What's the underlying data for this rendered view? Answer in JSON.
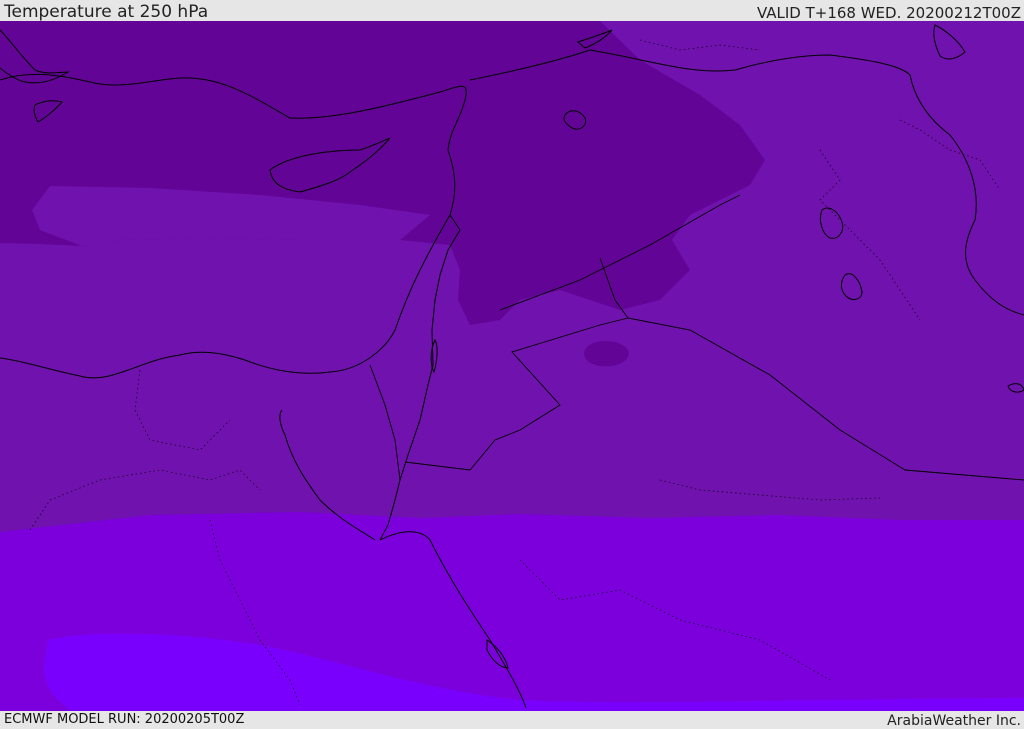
{
  "header": {
    "title": "Temperature at 250 hPa",
    "valid_time": "VALID T+168 WED. 20200212T00Z"
  },
  "footer": {
    "model_run": "ECMWF MODEL RUN: 20200205T00Z",
    "credit": "ArabiaWeather Inc."
  },
  "map": {
    "field": "temperature",
    "level_hpa": 250,
    "colors": {
      "band_darkest": "#620496",
      "band_dark": "#7012ae",
      "band_mid": "#7413b7",
      "band_bright": "#7c00dc",
      "band_brightest": "#7a00fe",
      "coastline": "#000000"
    }
  }
}
